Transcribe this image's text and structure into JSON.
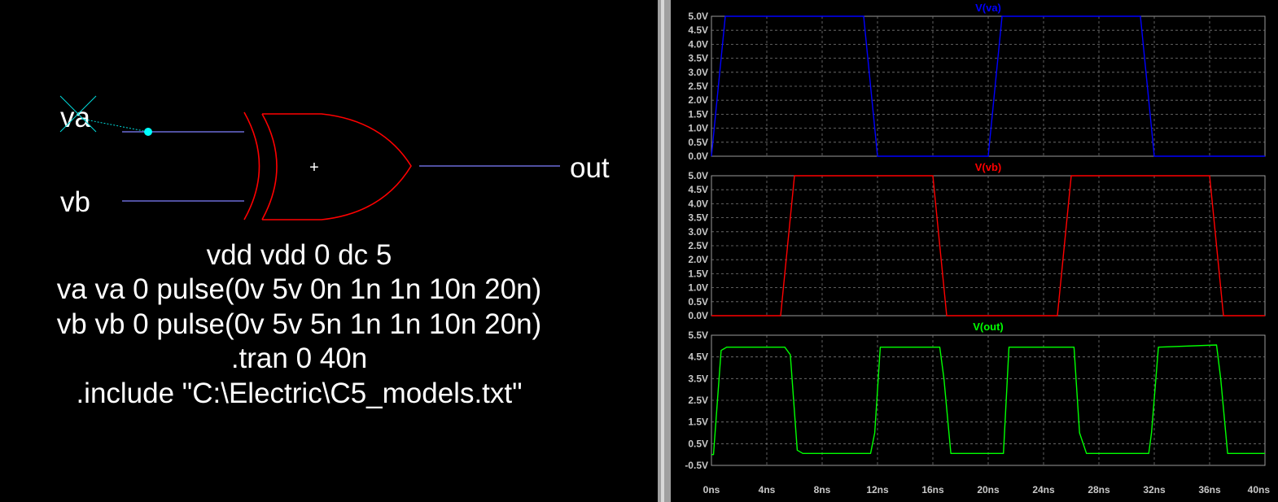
{
  "schematic": {
    "labels": {
      "va": "va",
      "vb": "vb",
      "out": "out",
      "gate_origin": "+"
    },
    "spice_directives": [
      "vdd vdd 0 dc 5",
      "va va 0 pulse(0v 5v 0n 1n 1n 10n 20n)",
      "vb vb 0 pulse(0v 5v 5n 1n 1n 10n 20n)",
      ".tran 0 40n",
      ".include \"C:\\Electric\\C5_models.txt\""
    ],
    "colors": {
      "wire": "#8080ff",
      "gate": "#ff0000",
      "probe": "#00ffff",
      "text": "#ffffff"
    }
  },
  "waveforms": {
    "x_ticks": [
      "0ns",
      "4ns",
      "8ns",
      "12ns",
      "16ns",
      "20ns",
      "24ns",
      "28ns",
      "32ns",
      "36ns",
      "40ns"
    ],
    "panes": [
      {
        "title": "V(va)",
        "color": "#0000ff",
        "y_ticks": [
          "5.0V",
          "4.5V",
          "4.0V",
          "3.5V",
          "3.0V",
          "2.5V",
          "2.0V",
          "1.5V",
          "1.0V",
          "0.5V",
          "0.0V"
        ]
      },
      {
        "title": "V(vb)",
        "color": "#ff0000",
        "y_ticks": [
          "5.0V",
          "4.5V",
          "4.0V",
          "3.5V",
          "3.0V",
          "2.5V",
          "2.0V",
          "1.5V",
          "1.0V",
          "0.5V",
          "0.0V"
        ]
      },
      {
        "title": "V(out)",
        "color": "#00ff00",
        "y_ticks": [
          "5.5V",
          "4.5V",
          "3.5V",
          "2.5V",
          "1.5V",
          "0.5V",
          "-0.5V"
        ]
      }
    ]
  },
  "chart_data": [
    {
      "type": "line",
      "title": "V(va)",
      "ylim": [
        0,
        5
      ],
      "xlim": [
        0,
        40
      ],
      "series": [
        {
          "name": "V(va)",
          "x": [
            0,
            1,
            11,
            12,
            20,
            21,
            31,
            32,
            40
          ],
          "y": [
            0,
            5,
            5,
            0,
            0,
            5,
            5,
            0,
            0
          ]
        }
      ]
    },
    {
      "type": "line",
      "title": "V(vb)",
      "ylim": [
        0,
        5
      ],
      "xlim": [
        0,
        40
      ],
      "series": [
        {
          "name": "V(vb)",
          "x": [
            0,
            5,
            6,
            16,
            17,
            25,
            26,
            36,
            37,
            40
          ],
          "y": [
            0,
            0,
            5,
            5,
            0,
            0,
            5,
            5,
            0,
            0
          ]
        }
      ]
    },
    {
      "type": "line",
      "title": "V(out)",
      "ylim": [
        -0.5,
        5.5
      ],
      "xlim": [
        0,
        40
      ],
      "series": [
        {
          "name": "V(out)",
          "x": [
            0,
            0.15,
            0.7,
            1.1,
            5.3,
            5.7,
            6.2,
            6.6,
            11.5,
            11.8,
            12.2,
            16.5,
            16.8,
            17.3,
            21.1,
            21.5,
            26.2,
            26.6,
            27.1,
            31.6,
            31.8,
            32.3,
            36.5,
            36.8,
            37.3,
            40
          ],
          "y": [
            0,
            0,
            4.8,
            4.95,
            4.95,
            4.6,
            0.2,
            0.05,
            0.05,
            1.0,
            4.95,
            4.95,
            3.5,
            0.05,
            0.05,
            4.95,
            4.95,
            1.0,
            0.05,
            0.05,
            1.0,
            4.95,
            5.05,
            3.5,
            0.05,
            0.05
          ]
        }
      ]
    }
  ]
}
